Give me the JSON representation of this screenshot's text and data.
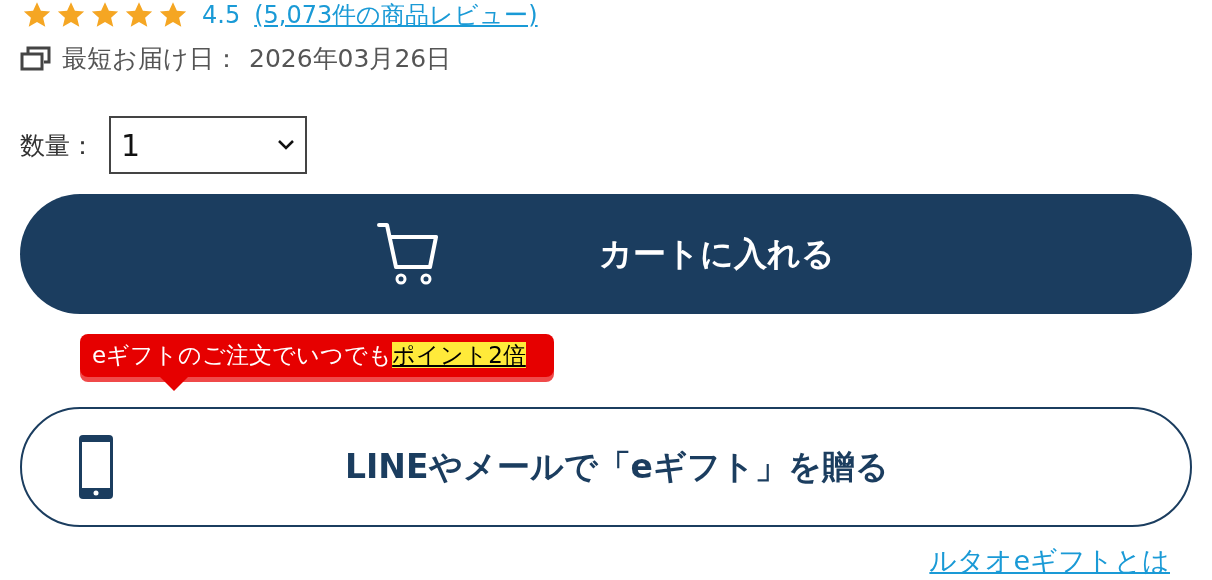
{
  "rating": {
    "stars": 5,
    "score": "4.5",
    "reviews_link": "(5,073件の商品レビュー)"
  },
  "delivery": {
    "label": "最短お届け日：",
    "date": "2026年03月26日"
  },
  "quantity": {
    "label": "数量：",
    "value": "1"
  },
  "cart_button": {
    "label": "カートに入れる"
  },
  "promo_tooltip": {
    "text": "eギフトのご注文でいつでも",
    "highlight": "ポイント2倍"
  },
  "gift_button": {
    "label": "LINEやメールで「eギフト」を贈る"
  },
  "gift_link": {
    "label": "ルタオeギフトとは"
  }
}
